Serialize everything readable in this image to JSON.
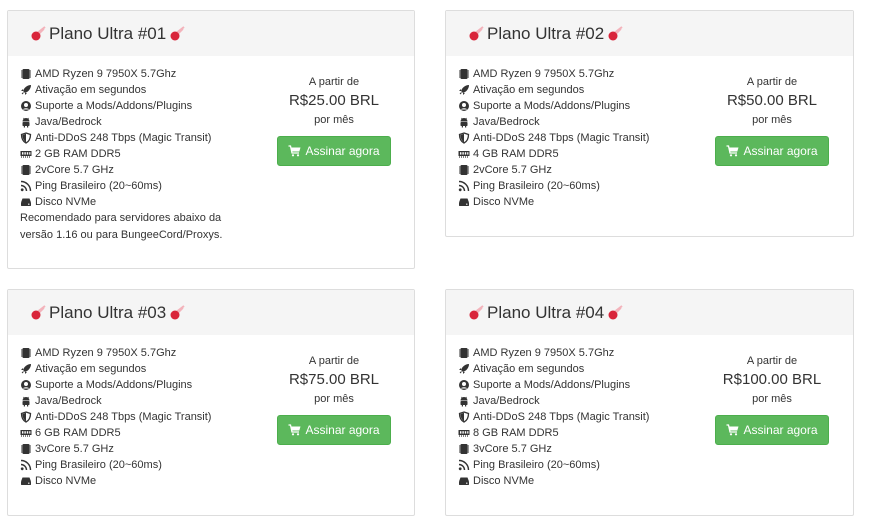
{
  "plans": [
    {
      "title": "Plano Ultra #01",
      "features": [
        {
          "icon": "cpu-icon",
          "text": "AMD Ryzen 9 7950X 5.7Ghz"
        },
        {
          "icon": "rocket-icon",
          "text": "Ativação em segundos"
        },
        {
          "icon": "support-icon",
          "text": "Suporte a Mods/Addons/Plugins"
        },
        {
          "icon": "android-icon",
          "text": "Java/Bedrock"
        },
        {
          "icon": "shield-icon",
          "text": "Anti-DDoS 248 Tbps (Magic Transit)"
        },
        {
          "icon": "memory-icon",
          "text": "2 GB RAM DDR5"
        },
        {
          "icon": "cpu-icon",
          "text": "2vCore 5.7 GHz"
        },
        {
          "icon": "rss-icon",
          "text": "Ping Brasileiro (20~60ms)"
        },
        {
          "icon": "hdd-icon",
          "text": "Disco NVMe"
        }
      ],
      "note": "Recomendado para servidores abaixo da versão 1.16 ou para BungeeCord/Proxys.",
      "from_label": "A partir de",
      "price": "R$25.00 BRL",
      "period": "por mês",
      "button_label": "Assinar agora"
    },
    {
      "title": "Plano Ultra #02",
      "features": [
        {
          "icon": "cpu-icon",
          "text": "AMD Ryzen 9 7950X 5.7Ghz"
        },
        {
          "icon": "rocket-icon",
          "text": "Ativação em segundos"
        },
        {
          "icon": "support-icon",
          "text": "Suporte a Mods/Addons/Plugins"
        },
        {
          "icon": "android-icon",
          "text": "Java/Bedrock"
        },
        {
          "icon": "shield-icon",
          "text": "Anti-DDoS 248 Tbps (Magic Transit)"
        },
        {
          "icon": "memory-icon",
          "text": "4 GB RAM DDR5"
        },
        {
          "icon": "cpu-icon",
          "text": "2vCore 5.7 GHz"
        },
        {
          "icon": "rss-icon",
          "text": "Ping Brasileiro (20~60ms)"
        },
        {
          "icon": "hdd-icon",
          "text": "Disco NVMe"
        }
      ],
      "note": "",
      "from_label": "A partir de",
      "price": "R$50.00 BRL",
      "period": "por mês",
      "button_label": "Assinar agora"
    },
    {
      "title": "Plano Ultra #03",
      "features": [
        {
          "icon": "cpu-icon",
          "text": "AMD Ryzen 9 7950X 5.7Ghz"
        },
        {
          "icon": "rocket-icon",
          "text": "Ativação em segundos"
        },
        {
          "icon": "support-icon",
          "text": "Suporte a Mods/Addons/Plugins"
        },
        {
          "icon": "android-icon",
          "text": "Java/Bedrock"
        },
        {
          "icon": "shield-icon",
          "text": "Anti-DDoS 248 Tbps (Magic Transit)"
        },
        {
          "icon": "memory-icon",
          "text": "6 GB RAM DDR5"
        },
        {
          "icon": "cpu-icon",
          "text": "3vCore 5.7 GHz"
        },
        {
          "icon": "rss-icon",
          "text": "Ping Brasileiro (20~60ms)"
        },
        {
          "icon": "hdd-icon",
          "text": "Disco NVMe"
        }
      ],
      "note": "",
      "from_label": "A partir de",
      "price": "R$75.00 BRL",
      "period": "por mês",
      "button_label": "Assinar agora"
    },
    {
      "title": "Plano Ultra #04",
      "features": [
        {
          "icon": "cpu-icon",
          "text": "AMD Ryzen 9 7950X 5.7Ghz"
        },
        {
          "icon": "rocket-icon",
          "text": "Ativação em segundos"
        },
        {
          "icon": "support-icon",
          "text": "Suporte a Mods/Addons/Plugins"
        },
        {
          "icon": "android-icon",
          "text": "Java/Bedrock"
        },
        {
          "icon": "shield-icon",
          "text": "Anti-DDoS 248 Tbps (Magic Transit)"
        },
        {
          "icon": "memory-icon",
          "text": "8 GB RAM DDR5"
        },
        {
          "icon": "cpu-icon",
          "text": "3vCore 5.7 GHz"
        },
        {
          "icon": "rss-icon",
          "text": "Ping Brasileiro (20~60ms)"
        },
        {
          "icon": "hdd-icon",
          "text": "Disco NVMe"
        }
      ],
      "note": "",
      "from_label": "A partir de",
      "price": "R$100.00 BRL",
      "period": "por mês",
      "button_label": "Assinar agora"
    }
  ],
  "colors": {
    "button": "#5cb85c",
    "header_bg": "#f5f5f5",
    "border": "#dddddd",
    "comet": "#d9243a"
  }
}
